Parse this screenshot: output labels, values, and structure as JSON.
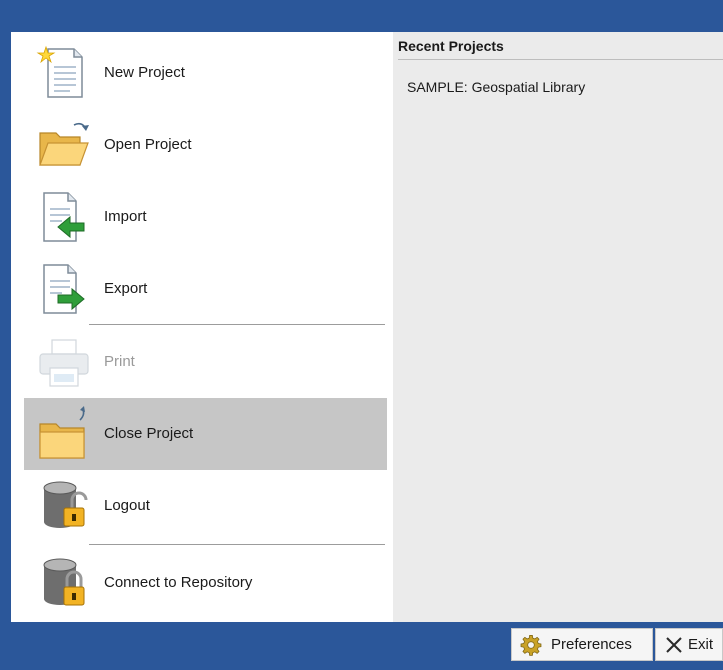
{
  "menu": {
    "items": [
      {
        "key": "new",
        "label": "New Project",
        "icon": "new-document-icon",
        "state": "normal"
      },
      {
        "key": "open",
        "label": "Open Project",
        "icon": "open-folder-icon",
        "state": "normal"
      },
      {
        "key": "import",
        "label": "Import",
        "icon": "import-document-icon",
        "state": "normal"
      },
      {
        "key": "export",
        "label": "Export",
        "icon": "export-document-icon",
        "state": "normal"
      },
      {
        "key": "print",
        "label": "Print",
        "icon": "printer-icon",
        "state": "disabled"
      },
      {
        "key": "close",
        "label": "Close Project",
        "icon": "close-folder-icon",
        "state": "selected"
      },
      {
        "key": "logout",
        "label": "Logout",
        "icon": "database-unlock-icon",
        "state": "normal"
      },
      {
        "key": "connect",
        "label": "Connect to Repository",
        "icon": "database-lock-icon",
        "state": "normal"
      }
    ]
  },
  "recent": {
    "title": "Recent Projects",
    "items": [
      "SAMPLE: Geospatial Library"
    ]
  },
  "footer": {
    "preferences_label": "Preferences",
    "preferences_icon": "gear-icon",
    "exit_label": "Exit",
    "exit_icon": "close-x-icon"
  },
  "colors": {
    "frame": "#2b579a",
    "selected": "#c6c6c6",
    "recent_pane": "#ebebeb"
  }
}
